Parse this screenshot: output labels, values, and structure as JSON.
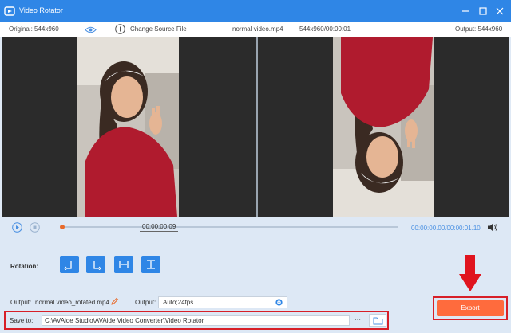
{
  "window": {
    "title": "Video Rotator",
    "minimize_icon": "minus-icon",
    "close_icon": "close-icon"
  },
  "infobar": {
    "original_label": "Original: 544x960",
    "change_source_label": "Change Source File",
    "file_name": "normal video.mp4",
    "resolution_duration": "544x960/00:00:01",
    "output_label": "Output: 544x960"
  },
  "playback": {
    "current_time": "00:00:00.09",
    "range": "00:00:00.00/00:00:01.10",
    "progress": 0.0
  },
  "rotation": {
    "label": "Rotation:",
    "buttons": [
      "rotate-left-icon",
      "rotate-right-icon",
      "flip-horizontal-icon",
      "flip-vertical-icon"
    ]
  },
  "output": {
    "file_label": "Output:",
    "file_value": "normal video_rotated.mp4",
    "format_label": "Output:",
    "format_value": "Auto;24fps"
  },
  "save": {
    "label": "Save to:",
    "path": "C:\\AVAide Studio\\AVAide Video Converter\\Video Rotator",
    "more": "···"
  },
  "export": {
    "label": "Export"
  },
  "colors": {
    "accent": "#2f86e6",
    "export": "#ff6b3d",
    "highlight": "#d71f28",
    "progress": "#e86a2a"
  }
}
